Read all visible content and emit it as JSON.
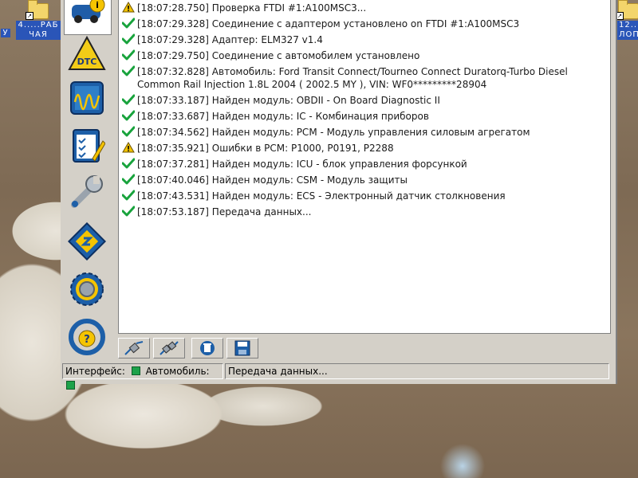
{
  "desktop": {
    "icons": [
      {
        "label": "У"
      },
      {
        "label": "4.....РАБ\nЧАЯ"
      },
      {
        "label": "12....\nЛОП"
      }
    ]
  },
  "sidebar": {
    "items": [
      {
        "name": "vehicle-info-icon"
      },
      {
        "name": "dtc-icon"
      },
      {
        "name": "oscilloscope-icon"
      },
      {
        "name": "checklist-icon"
      },
      {
        "name": "service-wrench-icon"
      },
      {
        "name": "chip-programming-icon"
      },
      {
        "name": "settings-gear-icon"
      },
      {
        "name": "help-steering-wheel-icon"
      }
    ]
  },
  "log": [
    {
      "type": "warn",
      "text": "[18:07:28.750] Проверка FTDI #1:A100MSC3..."
    },
    {
      "type": "ok",
      "text": "[18:07:29.328] Соединение с адаптером установлено on FTDI #1:A100MSC3"
    },
    {
      "type": "ok",
      "text": "[18:07:29.328] Адаптер:  ELM327 v1.4"
    },
    {
      "type": "ok",
      "text": "[18:07:29.750] Соединение с автомобилем установлено"
    },
    {
      "type": "ok",
      "text": "[18:07:32.828] Автомобиль: Ford Transit Connect/Tourneo Connect Duratorq-Turbo Diesel Common Rail Injection 1.8L 2004 ( 2002.5 MY ), VIN: WF0*********28904"
    },
    {
      "type": "ok",
      "text": "[18:07:33.187] Найден модуль:  OBDII - On Board Diagnostic II"
    },
    {
      "type": "ok",
      "text": "[18:07:33.687] Найден модуль:  IC - Комбинация приборов"
    },
    {
      "type": "ok",
      "text": "[18:07:34.562] Найден модуль:  PCM - Модуль управления силовым агрегатом"
    },
    {
      "type": "warn",
      "text": "[18:07:35.921] Ошибки в PCM: P1000, P0191, P2288"
    },
    {
      "type": "ok",
      "text": "[18:07:37.281] Найден модуль:  ICU - блок управления форсункой"
    },
    {
      "type": "ok",
      "text": "[18:07:40.046] Найден модуль:  CSM - Модуль защиты"
    },
    {
      "type": "ok",
      "text": "[18:07:43.531] Найден модуль:  ECS - Электронный датчик столкновения"
    },
    {
      "type": "ok",
      "text": "[18:07:53.187] Передача данных..."
    }
  ],
  "toolbar": {
    "buttons": [
      {
        "name": "connect-icon"
      },
      {
        "name": "disconnect-icon"
      },
      {
        "name": "clear-log-icon"
      },
      {
        "name": "save-log-icon"
      }
    ]
  },
  "status": {
    "interface_label": "Интерфейс:",
    "vehicle_label": "Автомобиль:",
    "message": "Передача данных...",
    "led_color": "#1da24a"
  },
  "colors": {
    "ok": "#18a33c",
    "warn": "#f2c200",
    "log_bg": "#ffffff",
    "panel_bg": "#d4d0c8"
  }
}
